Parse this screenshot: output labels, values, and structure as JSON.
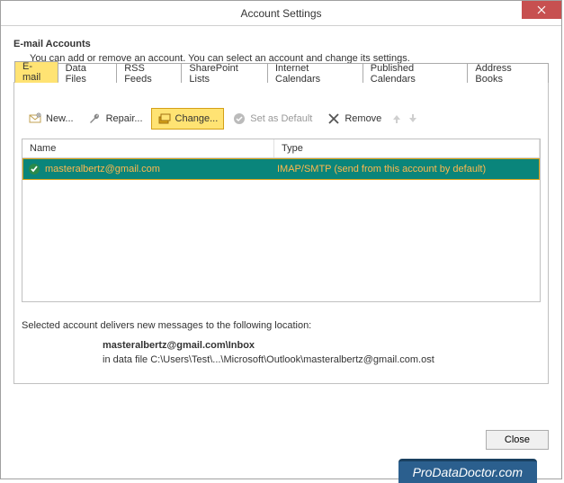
{
  "window": {
    "title": "Account Settings"
  },
  "header": {
    "title": "E-mail Accounts",
    "description": "You can add or remove an account. You can select an account and change its settings."
  },
  "tabs": [
    {
      "label": "E-mail",
      "active": true
    },
    {
      "label": "Data Files"
    },
    {
      "label": "RSS Feeds"
    },
    {
      "label": "SharePoint Lists"
    },
    {
      "label": "Internet Calendars"
    },
    {
      "label": "Published Calendars"
    },
    {
      "label": "Address Books"
    }
  ],
  "toolbar": {
    "new": "New...",
    "repair": "Repair...",
    "change": "Change...",
    "set_default": "Set as Default",
    "remove": "Remove"
  },
  "list": {
    "columns": {
      "name": "Name",
      "type": "Type"
    },
    "rows": [
      {
        "name": "masteralbertz@gmail.com",
        "type": "IMAP/SMTP (send from this account by default)"
      }
    ]
  },
  "delivery": {
    "label": "Selected account delivers new messages to the following location:",
    "location": "masteralbertz@gmail.com\\Inbox",
    "path": "in data file C:\\Users\\Test\\...\\Microsoft\\Outlook\\masteralbertz@gmail.com.ost"
  },
  "footer": {
    "close": "Close"
  },
  "watermark": "ProDataDoctor.com"
}
